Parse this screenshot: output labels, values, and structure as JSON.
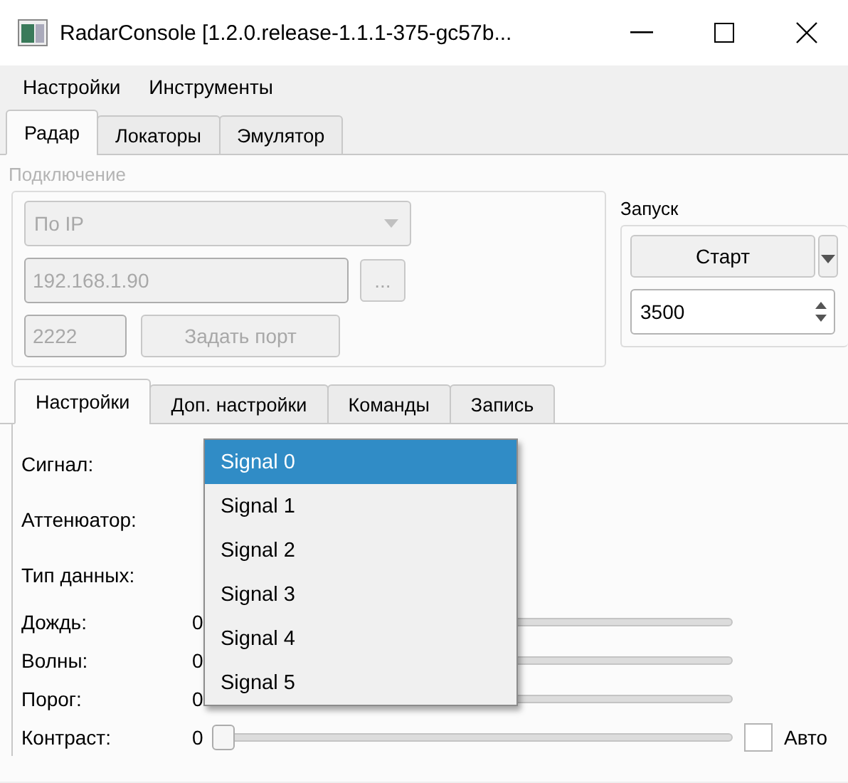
{
  "window": {
    "title": "RadarConsole [1.2.0.release-1.1.1-375-gc57b..."
  },
  "menu": [
    "Настройки",
    "Инструменты"
  ],
  "tabs": [
    {
      "label": "Радар",
      "selected": true
    },
    {
      "label": "Локаторы",
      "selected": false
    },
    {
      "label": "Эмулятор",
      "selected": false
    }
  ],
  "connection": {
    "title": "Подключение",
    "disabled": true,
    "mode": {
      "value": "По IP"
    },
    "address": {
      "value": "192.168.1.90"
    },
    "browse_button": "...",
    "port": {
      "value": "2222"
    },
    "set_port_button": "Задать порт"
  },
  "launch": {
    "title": "Запуск",
    "start_button": "Старт",
    "interval": {
      "value": "3500"
    }
  },
  "settings_tabs": [
    {
      "label": "Настройки",
      "selected": true
    },
    {
      "label": "Доп. настройки",
      "selected": false
    },
    {
      "label": "Команды",
      "selected": false
    },
    {
      "label": "Запись",
      "selected": false
    }
  ],
  "settings": [
    {
      "kind": "combo",
      "label": "Сигнал:"
    },
    {
      "kind": "combo",
      "label": "Аттенюатор:"
    },
    {
      "kind": "combo",
      "label": "Тип данных:"
    },
    {
      "kind": "covered_slider",
      "label": "Дождь:",
      "reading": "0",
      "level": 0
    },
    {
      "kind": "covered_slider",
      "label": "Волны:",
      "reading": "0",
      "level": 0
    },
    {
      "kind": "covered_slider",
      "label": "Порог:",
      "reading": "0",
      "level": 0
    },
    {
      "kind": "slider",
      "label": "Контраст:",
      "reading": "0",
      "level": 0,
      "auto": {
        "label": "Авто",
        "checked": false
      }
    }
  ],
  "dropdown": {
    "items": [
      {
        "label": "Signal 0",
        "selected": true
      },
      {
        "label": "Signal 1",
        "selected": false
      },
      {
        "label": "Signal 2",
        "selected": false
      },
      {
        "label": "Signal 3",
        "selected": false
      },
      {
        "label": "Signal 4",
        "selected": false
      },
      {
        "label": "Signal 5",
        "selected": false
      }
    ]
  }
}
